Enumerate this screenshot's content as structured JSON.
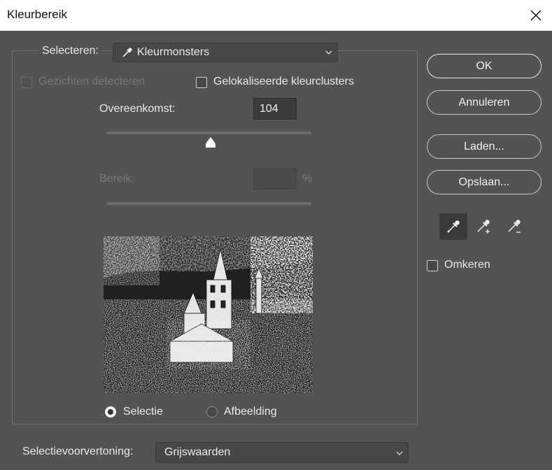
{
  "window": {
    "title": "Kleurbereik"
  },
  "select": {
    "label": "Selecteren:",
    "value": "Kleurmonsters"
  },
  "options": {
    "detect_faces": "Gezichten detecteren",
    "localized_clusters": "Gelokaliseerde kleurclusters"
  },
  "fuzziness": {
    "label": "Overeenkomst:",
    "value": "104",
    "slider_fraction": 0.51
  },
  "range": {
    "label": "Bereik:",
    "value": "",
    "unit": "%"
  },
  "preview_mode": {
    "selection": "Selectie",
    "image": "Afbeelding",
    "selected": "selection"
  },
  "selection_preview": {
    "label": "Selectievoorvertoning:",
    "value": "Grijswaarden"
  },
  "buttons": {
    "ok": "OK",
    "cancel": "Annuleren",
    "load": "Laden...",
    "save": "Opslaan..."
  },
  "invert": {
    "label": "Omkeren"
  },
  "icons": {
    "close": "close-icon",
    "eyedropper": "eyedropper-icon",
    "eyedropper_add": "eyedropper-plus-icon",
    "eyedropper_subtract": "eyedropper-minus-icon",
    "chevron": "chevron-down-icon"
  },
  "colors": {
    "background": "#535353",
    "titlebar": "#ffffff"
  }
}
